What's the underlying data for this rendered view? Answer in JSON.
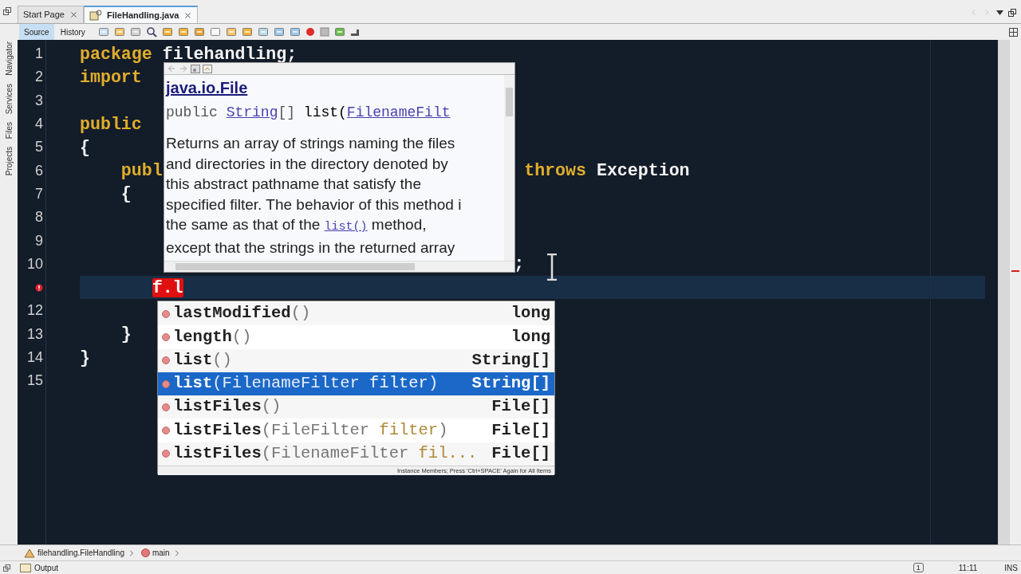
{
  "side_tabs": [
    {
      "label": "Navigator"
    },
    {
      "label": "Services"
    },
    {
      "label": "Files"
    },
    {
      "label": "Projects"
    }
  ],
  "tabs": [
    {
      "label": "Start Page",
      "selected": false
    },
    {
      "label": "FileHandling.java",
      "selected": true
    }
  ],
  "view_tabs": [
    {
      "label": "Source",
      "selected": true
    },
    {
      "label": "History",
      "selected": false
    }
  ],
  "code_lines": [
    {
      "number": "1",
      "segments": [
        {
          "text": "package ",
          "kind": "keyword"
        },
        {
          "text": "filehandling;",
          "kind": "plain"
        }
      ]
    },
    {
      "number": "2",
      "segments": [
        {
          "text": "import",
          "kind": "keyword"
        }
      ]
    },
    {
      "number": "3"
    },
    {
      "number": "4",
      "segments": [
        {
          "text": "public",
          "kind": "keyword"
        }
      ]
    },
    {
      "number": "5",
      "segments": [
        {
          "text": "{",
          "kind": "plain"
        }
      ]
    },
    {
      "number": "6",
      "segments": [
        {
          "text": "publ",
          "kind": "keyword"
        },
        {
          "text": "throws",
          "kind": "keyword"
        },
        {
          "text": "Exception",
          "kind": "plain"
        }
      ]
    },
    {
      "number": "7",
      "segments": [
        {
          "text": "{",
          "kind": "plain"
        }
      ]
    },
    {
      "number": "8"
    },
    {
      "number": "9"
    },
    {
      "number": "10",
      "segments": [
        {
          "text": ";",
          "kind": "plain"
        }
      ]
    },
    {
      "current": true,
      "error": true,
      "segments": [
        {
          "text": "f.l",
          "kind": "error"
        }
      ]
    },
    {
      "number": "12"
    },
    {
      "number": "13",
      "segments": [
        {
          "text": "}",
          "kind": "plain"
        }
      ]
    },
    {
      "number": "14",
      "segments": [
        {
          "text": "}",
          "kind": "plain"
        }
      ]
    },
    {
      "number": "15"
    }
  ],
  "doc_popup": {
    "title": "java.io.File",
    "signature": [
      {
        "text": "public ",
        "kind": "plain"
      },
      {
        "text": "String",
        "kind": "link"
      },
      {
        "text": "[] ",
        "kind": "plain"
      },
      {
        "text": "list(",
        "kind": "name"
      },
      {
        "text": "FilenameFilt",
        "kind": "link"
      }
    ],
    "description_lines": [
      [
        {
          "text": "Returns an array of strings naming the files",
          "kind": "text"
        }
      ],
      [
        {
          "text": "and directories in the directory denoted by",
          "kind": "text"
        }
      ],
      [
        {
          "text": "this abstract pathname that satisfy the",
          "kind": "text"
        }
      ],
      [
        {
          "text": "specified filter. The behavior of this method i",
          "kind": "text"
        }
      ],
      [
        {
          "text": "the same as that of the ",
          "kind": "text"
        },
        {
          "text": "list()",
          "kind": "link"
        },
        {
          "text": " method,",
          "kind": "text"
        }
      ],
      [
        {
          "text": "except that the strings in the returned array",
          "kind": "text"
        }
      ]
    ]
  },
  "completion": {
    "items": [
      {
        "name": "lastModified",
        "parts": [
          {
            "text": "()",
            "kind": "punct"
          }
        ],
        "type": "long",
        "selected": false
      },
      {
        "name": "length",
        "parts": [
          {
            "text": "()",
            "kind": "punct"
          }
        ],
        "type": "long",
        "selected": false
      },
      {
        "name": "list",
        "parts": [
          {
            "text": "()",
            "kind": "punct"
          }
        ],
        "type": "String[]",
        "selected": false
      },
      {
        "name": "list",
        "parts": [
          {
            "text": "(",
            "kind": "punct"
          },
          {
            "text": "FilenameFilter ",
            "kind": "ptype"
          },
          {
            "text": "filter",
            "kind": "pname"
          },
          {
            "text": ")",
            "kind": "punct"
          }
        ],
        "type": "String[]",
        "selected": true
      },
      {
        "name": "listFiles",
        "parts": [
          {
            "text": "()",
            "kind": "punct"
          }
        ],
        "type": "File[]",
        "selected": false
      },
      {
        "name": "listFiles",
        "parts": [
          {
            "text": "(",
            "kind": "punct"
          },
          {
            "text": "FileFilter ",
            "kind": "ptype"
          },
          {
            "text": "filter",
            "kind": "pname"
          },
          {
            "text": ")",
            "kind": "punct"
          }
        ],
        "type": "File[]",
        "selected": false
      },
      {
        "name": "listFiles",
        "parts": [
          {
            "text": "(",
            "kind": "punct"
          },
          {
            "text": "FilenameFilter ",
            "kind": "ptype"
          },
          {
            "text": "fil...",
            "kind": "pname"
          }
        ],
        "type": "File[]",
        "selected": false
      }
    ],
    "footer": "Instance Members; Press 'Ctrl+SPACE' Again for All Items"
  },
  "breadcrumbs": [
    {
      "label": "filehandling.FileHandling",
      "kind": "class"
    },
    {
      "label": "main",
      "kind": "method"
    }
  ],
  "status_bar": {
    "panel": "Output",
    "notifications": "1",
    "position": "11:11",
    "mode": "INS"
  }
}
